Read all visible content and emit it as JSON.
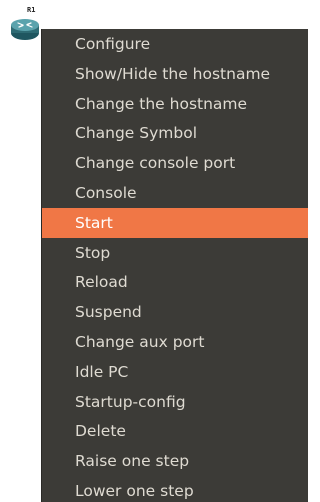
{
  "device": {
    "label": "R1",
    "icon": "router-icon",
    "icon_color": "#2e6b74"
  },
  "menu": {
    "background": "#3c3b37",
    "text_color": "#dfdbd2",
    "highlight_color": "#f07746",
    "highlighted_item": "Start",
    "items": [
      {
        "label": "Configure"
      },
      {
        "label": "Show/Hide the hostname"
      },
      {
        "label": "Change the hostname"
      },
      {
        "label": "Change Symbol"
      },
      {
        "label": "Change console port"
      },
      {
        "label": "Console"
      },
      {
        "label": "Start"
      },
      {
        "label": "Stop"
      },
      {
        "label": "Reload"
      },
      {
        "label": "Suspend"
      },
      {
        "label": "Change aux port"
      },
      {
        "label": "Idle PC"
      },
      {
        "label": "Startup-config"
      },
      {
        "label": "Delete"
      },
      {
        "label": "Raise one step"
      },
      {
        "label": "Lower one step"
      }
    ]
  }
}
